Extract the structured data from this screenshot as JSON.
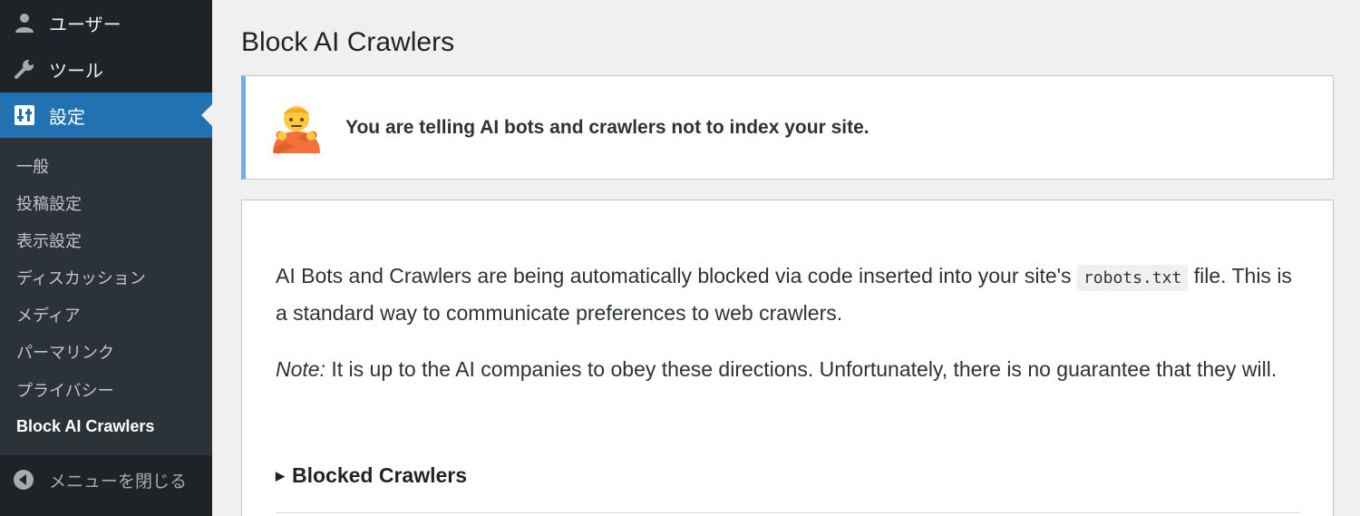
{
  "sidebar": {
    "users_label": "ユーザー",
    "tools_label": "ツール",
    "settings_label": "設定",
    "submenu": [
      "一般",
      "投稿設定",
      "表示設定",
      "ディスカッション",
      "メディア",
      "パーマリンク",
      "プライバシー",
      "Block AI Crawlers"
    ],
    "collapse_label": "メニューを閉じる",
    "icons": [
      "user-icon",
      "wrench-icon",
      "settings-sliders-icon",
      "collapse-arrow-icon"
    ],
    "colors": {
      "background": "#1d2327",
      "submenu_bg": "#2c3338",
      "active": "#2271b1"
    }
  },
  "page": {
    "title": "Block AI Crawlers",
    "notice": {
      "message": "You are telling AI bots and crawlers not to index your site.",
      "icon": "person-gesturing-no-emoji",
      "border_color": "#72aee6"
    },
    "card": {
      "p1_before": "AI Bots and Crawlers are being automatically blocked via code inserted into your site's ",
      "p1_code": "robots.txt",
      "p1_after": " file. This is a standard way to communicate preferences to web crawlers.",
      "p2_em": "Note:",
      "p2_text": " It is up to the AI companies to obey these directions. Unfortunately, there is no guarantee that they will.",
      "details_label": "Blocked Crawlers",
      "details_icon": "disclosure-triangle-icon"
    }
  }
}
